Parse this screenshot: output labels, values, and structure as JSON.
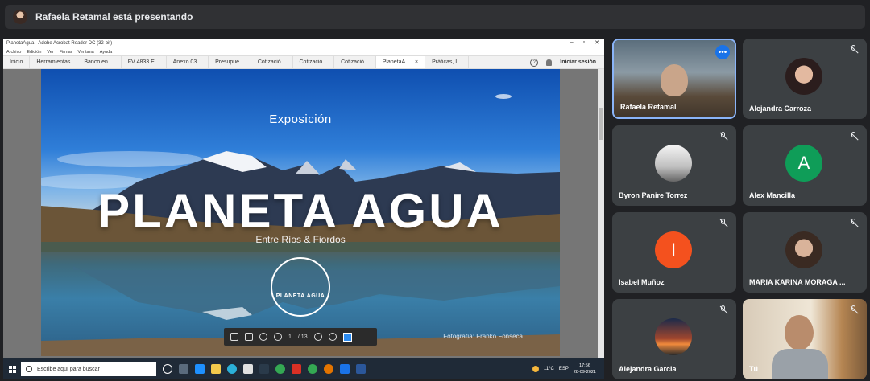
{
  "presenting": {
    "text": "Rafaela Retamal está presentando"
  },
  "acrobat": {
    "window_title": "PlanetaAgua - Adobe Acrobat Reader DC (32-bit)",
    "menu": [
      "Archivo",
      "Edición",
      "Ver",
      "Firmar",
      "Ventana",
      "Ayuda"
    ],
    "tabs": [
      "Inicio",
      "Herramientas",
      "Banco en ...",
      "FV 4833 E...",
      "Anexo 03...",
      "Presupue...",
      "Cotizació...",
      "Cotizació...",
      "Cotizació...",
      "PlanetaA...",
      "Práficas, I..."
    ],
    "active_tab_index": 9,
    "tab_close": "×",
    "sign_in": "Iniciar sesión",
    "page_current": "1",
    "page_total": "/ 13"
  },
  "slide": {
    "top_label": "Exposición",
    "title": "PLANETA AGUA",
    "subtitle": "Entre Ríos & Fiordos",
    "logo_text": "PLANETA AGUA",
    "credit": "Fotografía: Franko Fonseca"
  },
  "taskbar": {
    "search_placeholder": "Escribe aquí para buscar",
    "temperature": "11°C",
    "language": "ESP",
    "time": "17:56",
    "date": "28-09-2021"
  },
  "participants": [
    {
      "name": "Rafaela Retamal",
      "type": "video",
      "muted": false,
      "pinned": true
    },
    {
      "name": "Alejandra Carroza",
      "type": "photo",
      "muted": true
    },
    {
      "name": "Byron Panire Torrez",
      "type": "photo",
      "muted": true
    },
    {
      "name": "Alex Mancilla",
      "type": "letter",
      "letter": "A",
      "color": "#0f9d58",
      "muted": true
    },
    {
      "name": "Isabel Muñoz",
      "type": "letter",
      "letter": "I",
      "color": "#f4511e",
      "muted": true
    },
    {
      "name": "MARIA KARINA MORAGA ...",
      "type": "photo",
      "muted": true
    },
    {
      "name": "Alejandra Garcia",
      "type": "photo",
      "muted": true
    },
    {
      "name": "Tú",
      "type": "video",
      "muted": true
    }
  ],
  "colors": {
    "accent": "#8ab4f8",
    "more_button": "#1a73e8",
    "tile_bg": "#3c4043",
    "app_bg": "#202124"
  }
}
